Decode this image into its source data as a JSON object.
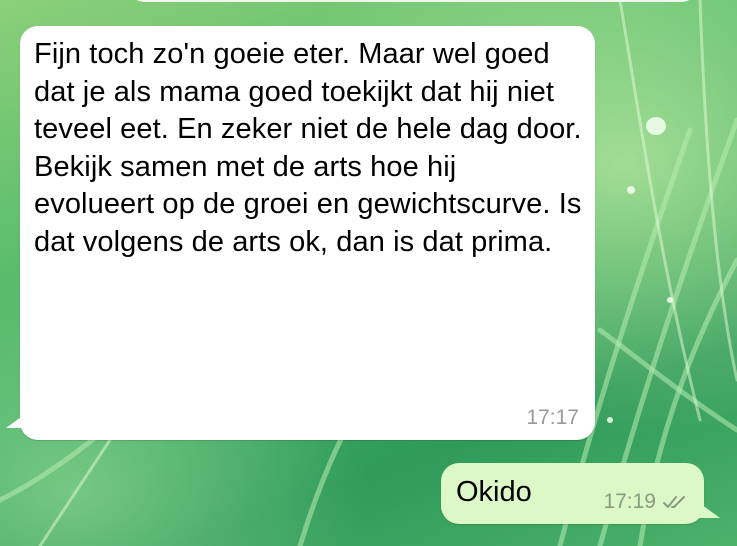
{
  "colors": {
    "incoming_bubble": "#ffffff",
    "outgoing_bubble": "#dcf8c6",
    "timestamp": "#9a9a9a",
    "read_ticks": "#8a9a82"
  },
  "messages": [
    {
      "direction": "incoming",
      "text": "Fijn toch zo'n goeie eter. Maar wel goed dat je als mama goed toekijkt dat hij niet teveel eet. En zeker niet de hele dag door. Bekijk samen met de arts hoe hij evolueert op de groei en gewichtscurve. Is dat volgens de arts ok, dan is dat prima.",
      "time": "17:17"
    },
    {
      "direction": "outgoing",
      "text": "Okido",
      "time": "17:19",
      "status_icon": "double-check-icon"
    }
  ]
}
